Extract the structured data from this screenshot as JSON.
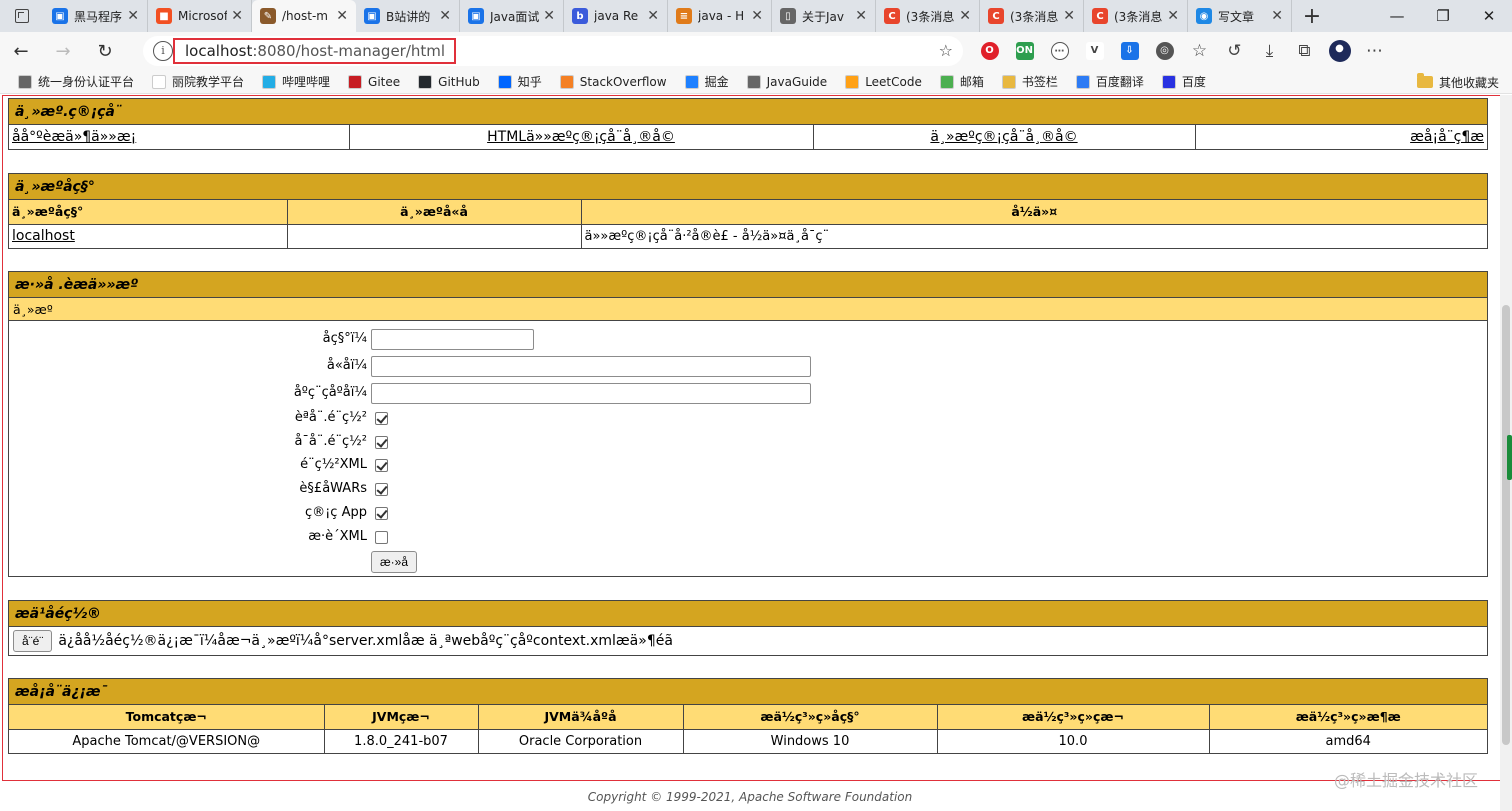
{
  "browser": {
    "tabs": [
      {
        "label": "黑马程序",
        "color": "#1a73e8",
        "glyph": "▣",
        "active": false
      },
      {
        "label": "Microsoft",
        "color": "#f25022",
        "glyph": "■",
        "active": false
      },
      {
        "label": "/host-m",
        "color": "#8b5a2b",
        "glyph": "✎",
        "active": true
      },
      {
        "label": "B站讲的",
        "color": "#1a73e8",
        "glyph": "▣",
        "active": false
      },
      {
        "label": "Java面试",
        "color": "#1a73e8",
        "glyph": "▣",
        "active": false
      },
      {
        "label": "java Re",
        "color": "#3b5bdb",
        "glyph": "b",
        "active": false
      },
      {
        "label": "java - H",
        "color": "#e07b1a",
        "glyph": "≡",
        "active": false
      },
      {
        "label": "关于Jav",
        "color": "#666666",
        "glyph": "▯",
        "active": false
      },
      {
        "label": "(3条消息",
        "color": "#e8452c",
        "glyph": "C",
        "active": false
      },
      {
        "label": "(3条消息",
        "color": "#e8452c",
        "glyph": "C",
        "active": false
      },
      {
        "label": "(3条消息",
        "color": "#e8452c",
        "glyph": "C",
        "active": false
      },
      {
        "label": "写文章",
        "color": "#1e88e5",
        "glyph": "◉",
        "active": false
      }
    ],
    "new_tab": "+",
    "window_controls": {
      "minimize": "—",
      "restore": "❐",
      "close": "✕"
    },
    "nav": {
      "back": "←",
      "forward": "→",
      "reload": "↻"
    },
    "url_host": "localhost",
    "url_path": ":8080/host-manager/html",
    "omni_info": "i",
    "omni_star": "☆",
    "bookmarks": [
      {
        "label": "统一身份认证平台",
        "color": "#666666"
      },
      {
        "label": "丽院教学平台",
        "color": "#ffffff"
      },
      {
        "label": "哔哩哔哩",
        "color": "#23ade5"
      },
      {
        "label": "Gitee",
        "color": "#c71d23"
      },
      {
        "label": "GitHub",
        "color": "#24292e"
      },
      {
        "label": "知乎",
        "color": "#0066ff"
      },
      {
        "label": "StackOverflow",
        "color": "#f48024"
      },
      {
        "label": "掘金",
        "color": "#1e80ff"
      },
      {
        "label": "JavaGuide",
        "color": "#666666"
      },
      {
        "label": "LeetCode",
        "color": "#ffa116"
      },
      {
        "label": "邮箱",
        "color": "#4caf50"
      },
      {
        "label": "书签栏",
        "color": "#e8b840"
      },
      {
        "label": "百度翻译",
        "color": "#2d7bf4"
      },
      {
        "label": "百度",
        "color": "#2932e1"
      }
    ],
    "other_bookmarks": "其他收藏夹"
  },
  "page": {
    "section1": {
      "title": "ä¸»æº.ç®¡çå¨",
      "links": [
        "åå°ºèæä»¶ä»»æ¡",
        "HTMLä»»æºç®¡çå¨å¸®å©",
        "ä¸»æºç®¡çå¨å¸®å©",
        "æå¡å¨ç¶æ"
      ]
    },
    "section2": {
      "title": "ä¸»æºåç§°",
      "headers": [
        "ä¸»æºåç§°",
        "ä¸»æºå«å",
        "å½ä»¤"
      ],
      "row": {
        "host": "localhost",
        "alias": "",
        "command": "ä»»æºç®¡çå¨å·²å®è£ - å½ä»¤ä¸å¯ç¨"
      }
    },
    "section3": {
      "title": "æ·»å .èæä»»æº",
      "sub": "ä¸»æº",
      "fields": [
        {
          "label": "åç§°ï¼"
        },
        {
          "label": "å«åï¼"
        },
        {
          "label": "åºç¨çåºåï¼"
        }
      ],
      "checkboxes": [
        {
          "label": "èªå¨.é¨ç½²",
          "checked": true
        },
        {
          "label": "å¯å¨.é¨ç½²",
          "checked": true
        },
        {
          "label": "é¨ç½²XML",
          "checked": true
        },
        {
          "label": "è§£åWARs",
          "checked": true
        },
        {
          "label": "ç®¡ç App",
          "checked": true
        },
        {
          "label": "æ·è´XML",
          "checked": false
        }
      ],
      "button": "æ·»å "
    },
    "section4": {
      "title": "æä¹åéç½®",
      "button": "å¨é¨",
      "text": "ä¿å­å½åéç½®ä¿¡æ¯ï¼åæ¬ä¸»æºï¼å°server.xmlåæ ä¸ªwebåºç¨çåºcontext.xmlæä»¶éã"
    },
    "section5": {
      "title": "æå¡å¨ä¿¡æ¯",
      "headers": [
        "Tomcatçæ¬",
        "JVMçæ¬",
        "JVMä¾åºå",
        "æä½ç³»ç»åç§°",
        "æä½ç³»ç»çæ¬",
        "æä½ç³»ç»æ¶æ"
      ],
      "values": [
        "Apache Tomcat/@VERSION@",
        "1.8.0_241-b07",
        "Oracle Corporation",
        "Windows 10",
        "10.0",
        "amd64"
      ]
    },
    "footer": "Copyright © 1999-2021, Apache Software Foundation",
    "watermark": "@稀土掘金技术社区"
  }
}
